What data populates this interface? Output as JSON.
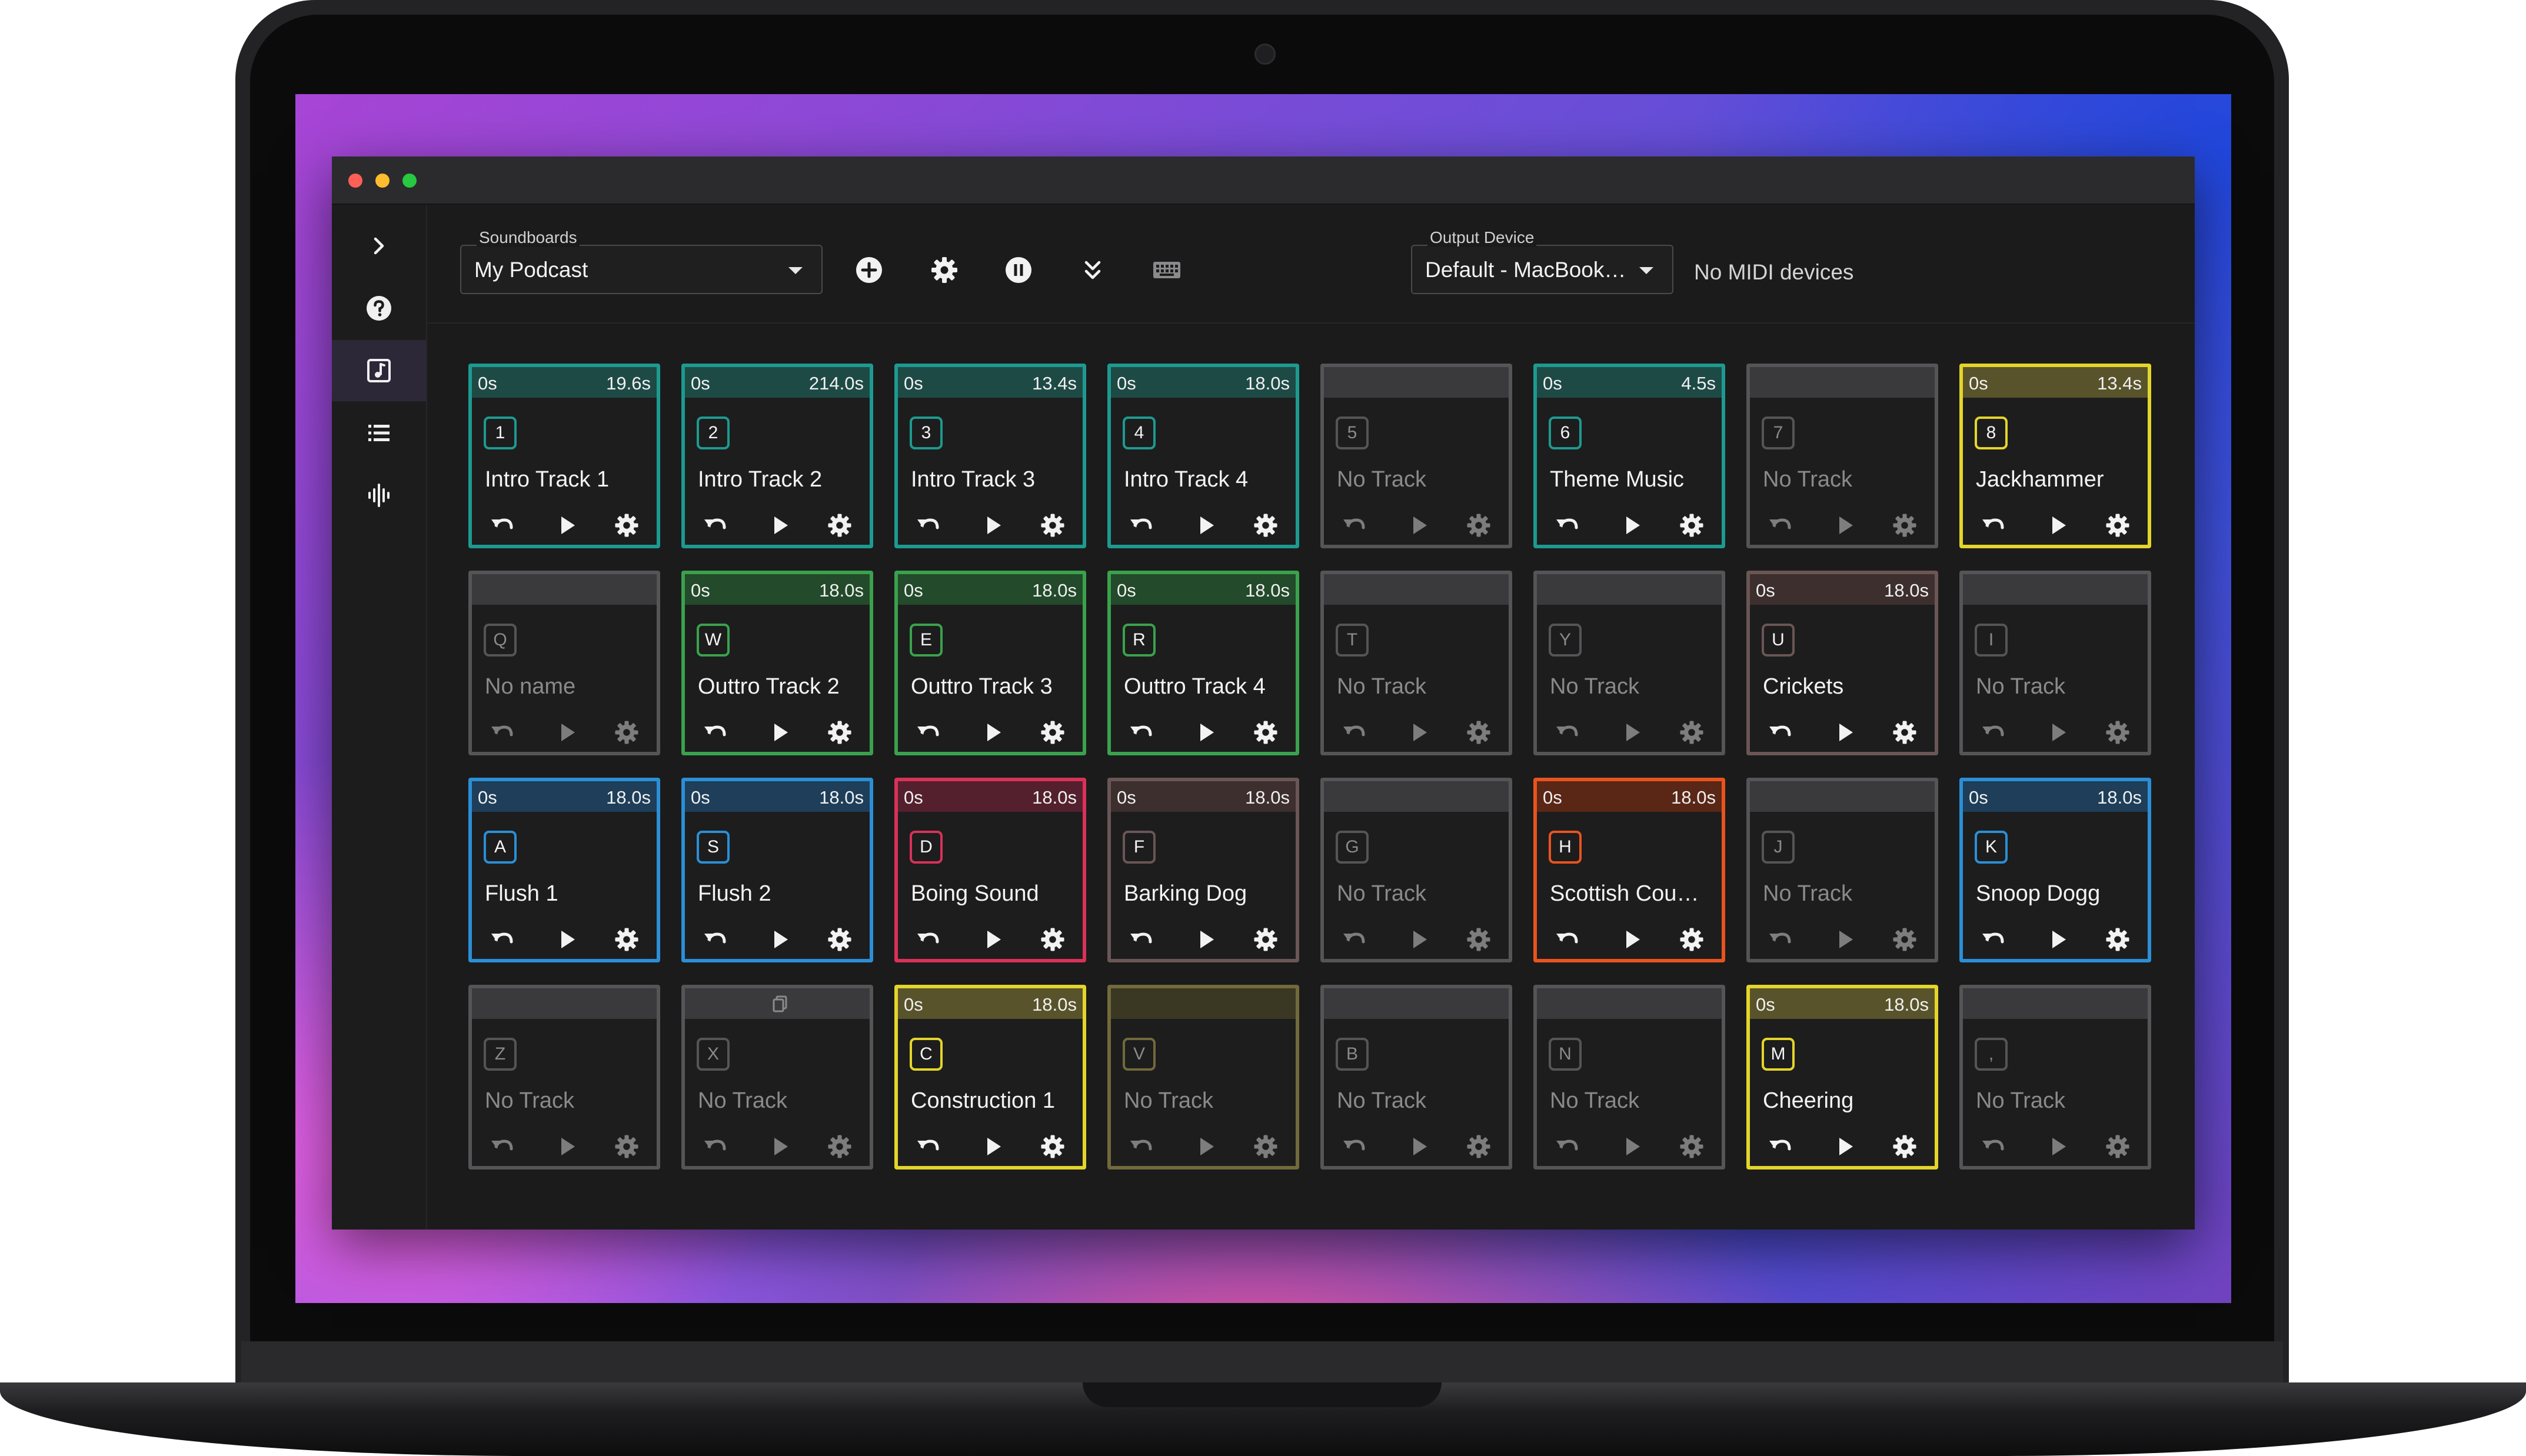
{
  "app": {
    "colors": {
      "teal": "#1d9a90",
      "teal_head": "#1e4a46",
      "green": "#3aa24c",
      "green_head": "#234a2a",
      "blue": "#2b8fd6",
      "blue_head": "#1e3e5a",
      "red": "#d93158",
      "red_head": "#54202e",
      "brown": "#6a5655",
      "brown_head": "#3c2f2e",
      "orange": "#e9531e",
      "orange_head": "#5a2716",
      "yellow": "#e4d52a",
      "yellow_head": "#58532a",
      "olive": "#716a3a",
      "olive_head": "#3a3722",
      "gray": "#555557",
      "gray_head": "#3a3a3c"
    }
  },
  "sidebar": {
    "items": [
      {
        "name": "expand",
        "icon": "chevron-right-icon"
      },
      {
        "name": "help",
        "icon": "help-circle-icon"
      },
      {
        "name": "soundboard",
        "icon": "music-note-icon",
        "active": true
      },
      {
        "name": "list",
        "icon": "list-icon"
      },
      {
        "name": "audio",
        "icon": "waveform-icon"
      }
    ]
  },
  "toolbar": {
    "soundboards_label": "Soundboards",
    "soundboard_value": "My Podcast",
    "output_label": "Output Device",
    "output_value": "Default - MacBook…",
    "midi_status": "No MIDI devices",
    "icons": [
      "add-circle-icon",
      "gear-icon",
      "pause-circle-icon",
      "collapse-double-chevron-icon",
      "keyboard-icon",
      "theme-toggle-icon"
    ]
  },
  "pads": [
    {
      "key": "1",
      "name": "Intro Track 1",
      "start": "0s",
      "duration": "19.6s",
      "color": "teal"
    },
    {
      "key": "2",
      "name": "Intro Track 2",
      "start": "0s",
      "duration": "214.0s",
      "color": "teal"
    },
    {
      "key": "3",
      "name": "Intro Track 3",
      "start": "0s",
      "duration": "13.4s",
      "color": "teal"
    },
    {
      "key": "4",
      "name": "Intro Track 4",
      "start": "0s",
      "duration": "18.0s",
      "color": "teal"
    },
    {
      "key": "5",
      "name": "No Track",
      "start": "",
      "duration": "",
      "color": "gray",
      "empty": true
    },
    {
      "key": "6",
      "name": "Theme Music",
      "start": "0s",
      "duration": "4.5s",
      "color": "teal"
    },
    {
      "key": "7",
      "name": "No Track",
      "start": "",
      "duration": "",
      "color": "gray",
      "empty": true
    },
    {
      "key": "8",
      "name": "Jackhammer",
      "start": "0s",
      "duration": "13.4s",
      "color": "yellow"
    },
    {
      "key": "Q",
      "name": "No name",
      "start": "",
      "duration": "",
      "color": "gray",
      "empty": true
    },
    {
      "key": "W",
      "name": "Outtro Track 2",
      "start": "0s",
      "duration": "18.0s",
      "color": "green"
    },
    {
      "key": "E",
      "name": "Outtro Track 3",
      "start": "0s",
      "duration": "18.0s",
      "color": "green"
    },
    {
      "key": "R",
      "name": "Outtro Track 4",
      "start": "0s",
      "duration": "18.0s",
      "color": "green"
    },
    {
      "key": "T",
      "name": "No Track",
      "start": "",
      "duration": "",
      "color": "gray",
      "empty": true
    },
    {
      "key": "Y",
      "name": "No Track",
      "start": "",
      "duration": "",
      "color": "gray",
      "empty": true
    },
    {
      "key": "U",
      "name": "Crickets",
      "start": "0s",
      "duration": "18.0s",
      "color": "brown"
    },
    {
      "key": "I",
      "name": "No Track",
      "start": "",
      "duration": "",
      "color": "gray",
      "empty": true
    },
    {
      "key": "A",
      "name": "Flush 1",
      "start": "0s",
      "duration": "18.0s",
      "color": "blue"
    },
    {
      "key": "S",
      "name": "Flush 2",
      "start": "0s",
      "duration": "18.0s",
      "color": "blue"
    },
    {
      "key": "D",
      "name": "Boing Sound",
      "start": "0s",
      "duration": "18.0s",
      "color": "red"
    },
    {
      "key": "F",
      "name": "Barking Dog",
      "start": "0s",
      "duration": "18.0s",
      "color": "brown"
    },
    {
      "key": "G",
      "name": "No Track",
      "start": "",
      "duration": "",
      "color": "gray",
      "empty": true
    },
    {
      "key": "H",
      "name": "Scottish Cou…",
      "start": "0s",
      "duration": "18.0s",
      "color": "orange"
    },
    {
      "key": "J",
      "name": "No Track",
      "start": "",
      "duration": "",
      "color": "gray",
      "empty": true
    },
    {
      "key": "K",
      "name": "Snoop Dogg",
      "start": "0s",
      "duration": "18.0s",
      "color": "blue"
    },
    {
      "key": "Z",
      "name": "No Track",
      "start": "",
      "duration": "",
      "color": "gray",
      "empty": true
    },
    {
      "key": "X",
      "name": "No Track",
      "start": "",
      "duration": "",
      "color": "gray",
      "empty": true,
      "copy": true
    },
    {
      "key": "C",
      "name": "Construction 1",
      "start": "0s",
      "duration": "18.0s",
      "color": "yellow"
    },
    {
      "key": "V",
      "name": "No Track",
      "start": "",
      "duration": "",
      "color": "olive",
      "empty": true
    },
    {
      "key": "B",
      "name": "No Track",
      "start": "",
      "duration": "",
      "color": "gray",
      "empty": true
    },
    {
      "key": "N",
      "name": "No Track",
      "start": "",
      "duration": "",
      "color": "gray",
      "empty": true
    },
    {
      "key": "M",
      "name": "Cheering",
      "start": "0s",
      "duration": "18.0s",
      "color": "yellow"
    },
    {
      "key": ",",
      "name": "No Track",
      "start": "",
      "duration": "",
      "color": "gray",
      "empty": true
    }
  ]
}
